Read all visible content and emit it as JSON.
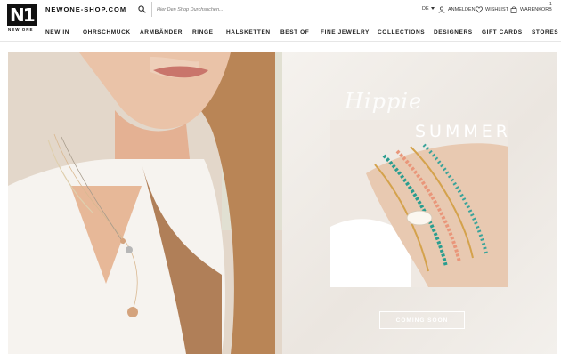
{
  "header": {
    "logo_sub": "NEW ONE",
    "site_name": "NEWONE-SHOP.COM",
    "search_placeholder": "Hier Den Shop Durchsuchen...",
    "language": "DE",
    "login_label": "ANMELDEN",
    "wishlist_label": "WISHLIST",
    "cart_label": "WARENKORB",
    "cart_count": "1"
  },
  "nav": {
    "items": [
      "NEW IN",
      "OHRSCHMUCK",
      "ARMBÄNDER",
      "RINGE",
      "HALSKETTEN",
      "BEST OF",
      "FINE JEWELRY",
      "COLLECTIONS",
      "DESIGNERS",
      "GIFT CARDS",
      "STORES"
    ]
  },
  "hero": {
    "script_title": "Hippie",
    "title": "SUMMER",
    "cta_label": "COMING SOON"
  },
  "colors": {
    "text": "#222222",
    "cta_border": "#ffffff"
  }
}
